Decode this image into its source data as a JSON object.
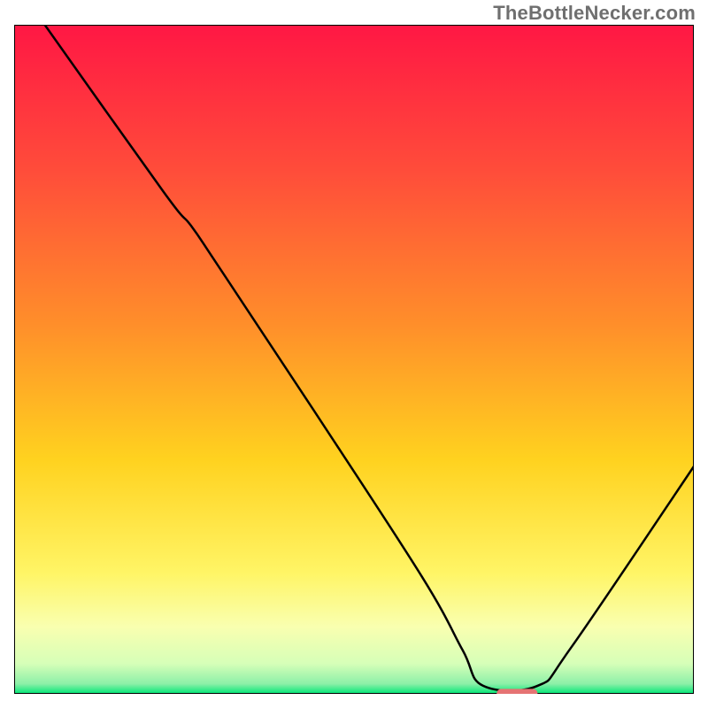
{
  "watermark": "TheBottleNecker.com",
  "chart_data": {
    "type": "line",
    "title": "",
    "xlabel": "",
    "ylabel": "",
    "xlim": [
      0,
      100
    ],
    "ylim": [
      0,
      100
    ],
    "axes_visible": false,
    "grid": false,
    "background_gradient": {
      "direction": "vertical",
      "stops": [
        {
          "offset": 0.0,
          "color": "#ff1744"
        },
        {
          "offset": 0.22,
          "color": "#ff4d3a"
        },
        {
          "offset": 0.45,
          "color": "#ff8f2a"
        },
        {
          "offset": 0.65,
          "color": "#ffd21f"
        },
        {
          "offset": 0.82,
          "color": "#fff566"
        },
        {
          "offset": 0.9,
          "color": "#f9ffb0"
        },
        {
          "offset": 0.955,
          "color": "#d6ffb8"
        },
        {
          "offset": 0.985,
          "color": "#8cf0a8"
        },
        {
          "offset": 1.0,
          "color": "#00e676"
        }
      ]
    },
    "plateau": {
      "x_start": 69,
      "x_end": 77,
      "y": 0.012
    },
    "marker": {
      "x_start": 71,
      "x_end": 77,
      "y": 0.012,
      "color": "#e57373"
    },
    "series": [
      {
        "name": "curve",
        "color": "#000000",
        "width": 2,
        "points": [
          {
            "x": 4.5,
            "y": 100.0
          },
          {
            "x": 22.0,
            "y": 75.0
          },
          {
            "x": 26.0,
            "y": 70.0
          },
          {
            "x": 30.0,
            "y": 64.0
          },
          {
            "x": 44.0,
            "y": 42.5
          },
          {
            "x": 60.0,
            "y": 17.5
          },
          {
            "x": 66.0,
            "y": 6.5
          },
          {
            "x": 69.0,
            "y": 1.2
          },
          {
            "x": 77.0,
            "y": 1.2
          },
          {
            "x": 82.0,
            "y": 7.0
          },
          {
            "x": 100.0,
            "y": 34.0
          }
        ]
      }
    ]
  }
}
